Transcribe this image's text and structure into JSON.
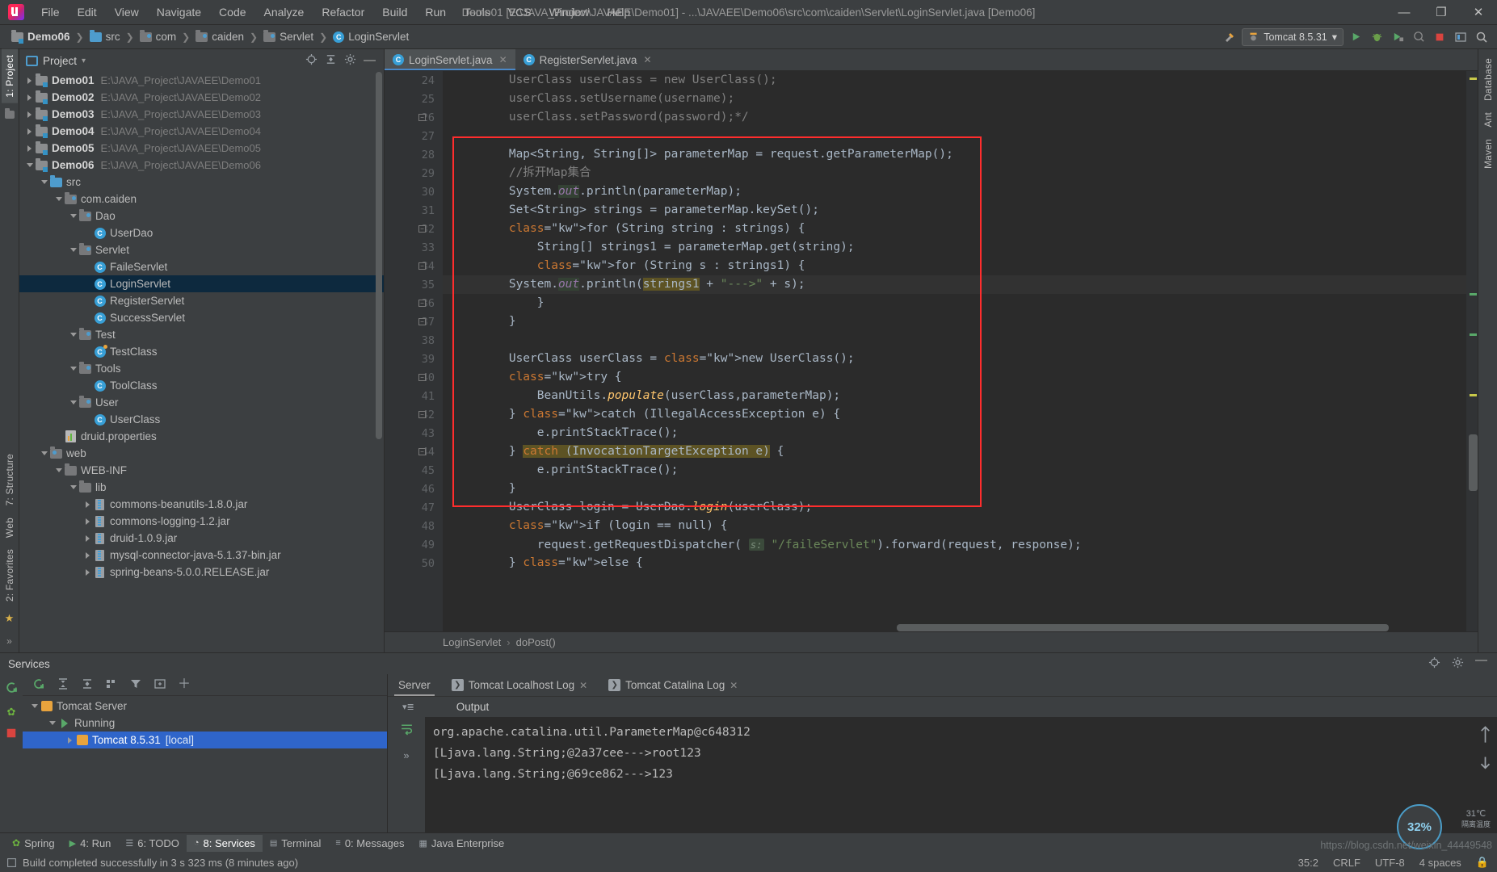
{
  "window": {
    "title": "Demo01 [E:\\JAVA_Project\\JAVAEE\\Demo01] - ...\\JAVAEE\\Demo06\\src\\com\\caiden\\Servlet\\LoginServlet.java [Demo06]",
    "minimize": "—",
    "maximize": "❐",
    "close": "✕"
  },
  "menu": [
    {
      "label": "File"
    },
    {
      "label": "Edit"
    },
    {
      "label": "View"
    },
    {
      "label": "Navigate"
    },
    {
      "label": "Code"
    },
    {
      "label": "Analyze"
    },
    {
      "label": "Refactor"
    },
    {
      "label": "Build"
    },
    {
      "label": "Run"
    },
    {
      "label": "Tools"
    },
    {
      "label": "VCS"
    },
    {
      "label": "Window"
    },
    {
      "label": "Help"
    }
  ],
  "breadcrumb": [
    {
      "label": "Demo06",
      "icon": "module-folder-icon",
      "bold": true
    },
    {
      "label": "src",
      "icon": "source-folder-icon",
      "bold": false
    },
    {
      "label": "com",
      "icon": "package-folder-icon",
      "bold": false
    },
    {
      "label": "caiden",
      "icon": "package-folder-icon",
      "bold": false
    },
    {
      "label": "Servlet",
      "icon": "package-folder-icon",
      "bold": false
    },
    {
      "label": "LoginServlet",
      "icon": "java-class-icon",
      "bold": false
    }
  ],
  "toolbar": {
    "run_config": "Tomcat 8.5.31",
    "dropdown_caret": "▾",
    "hammer_icon": "build-hammer-icon",
    "run_icon": "run-icon",
    "debug_icon": "debug-icon",
    "run_coverage_icon": "run-with-coverage-icon",
    "profile_icon": "profiler-icon",
    "stop_icon": "stop-icon",
    "layout_icon": "update-running-application-icon",
    "search_icon": "search-everywhere-icon"
  },
  "left_strip": {
    "tabs": [
      {
        "label": "1: Project",
        "active": true
      },
      {
        "label": "7: Structure",
        "active": false
      },
      {
        "label": "Web",
        "active": false
      },
      {
        "label": "2: Favorites",
        "active": false
      }
    ]
  },
  "right_strip": {
    "tabs": [
      {
        "label": "Database"
      },
      {
        "label": "Ant"
      },
      {
        "label": "Maven"
      }
    ]
  },
  "project_panel": {
    "title": "Project",
    "title_caret": "▾",
    "locate_icon": "scroll-from-source-icon",
    "collapse_icon": "collapse-all-icon",
    "settings_icon": "gear-icon",
    "hide_icon": "hide-icon",
    "tree": [
      {
        "indent": 0,
        "twist": "right",
        "icon": "module-icon",
        "label": "Demo01",
        "bold": true,
        "path": "E:\\JAVA_Project\\JAVAEE\\Demo01",
        "selected": false
      },
      {
        "indent": 0,
        "twist": "right",
        "icon": "module-icon",
        "label": "Demo02",
        "bold": true,
        "path": "E:\\JAVA_Project\\JAVAEE\\Demo02",
        "selected": false
      },
      {
        "indent": 0,
        "twist": "right",
        "icon": "module-icon",
        "label": "Demo03",
        "bold": true,
        "path": "E:\\JAVA_Project\\JAVAEE\\Demo03",
        "selected": false
      },
      {
        "indent": 0,
        "twist": "right",
        "icon": "module-icon",
        "label": "Demo04",
        "bold": true,
        "path": "E:\\JAVA_Project\\JAVAEE\\Demo04",
        "selected": false
      },
      {
        "indent": 0,
        "twist": "right",
        "icon": "module-icon",
        "label": "Demo05",
        "bold": true,
        "path": "E:\\JAVA_Project\\JAVAEE\\Demo05",
        "selected": false
      },
      {
        "indent": 0,
        "twist": "down",
        "icon": "module-icon",
        "label": "Demo06",
        "bold": true,
        "path": "E:\\JAVA_Project\\JAVAEE\\Demo06",
        "selected": false
      },
      {
        "indent": 1,
        "twist": "down",
        "icon": "source-folder-icon",
        "label": "src",
        "bold": false,
        "path": "",
        "selected": false
      },
      {
        "indent": 2,
        "twist": "down",
        "icon": "package-icon",
        "label": "com.caiden",
        "bold": false,
        "path": "",
        "selected": false
      },
      {
        "indent": 3,
        "twist": "down",
        "icon": "package-icon",
        "label": "Dao",
        "bold": false,
        "path": "",
        "selected": false
      },
      {
        "indent": 4,
        "twist": "none",
        "icon": "java-class-icon",
        "label": "UserDao",
        "bold": false,
        "path": "",
        "selected": false
      },
      {
        "indent": 3,
        "twist": "down",
        "icon": "package-icon",
        "label": "Servlet",
        "bold": false,
        "path": "",
        "selected": false
      },
      {
        "indent": 4,
        "twist": "none",
        "icon": "java-class-icon",
        "label": "FaileServlet",
        "bold": false,
        "path": "",
        "selected": false
      },
      {
        "indent": 4,
        "twist": "none",
        "icon": "java-class-icon",
        "label": "LoginServlet",
        "bold": false,
        "path": "",
        "selected": true
      },
      {
        "indent": 4,
        "twist": "none",
        "icon": "java-class-icon",
        "label": "RegisterServlet",
        "bold": false,
        "path": "",
        "selected": false
      },
      {
        "indent": 4,
        "twist": "none",
        "icon": "java-class-icon",
        "label": "SuccessServlet",
        "bold": false,
        "path": "",
        "selected": false
      },
      {
        "indent": 3,
        "twist": "down",
        "icon": "package-icon",
        "label": "Test",
        "bold": false,
        "path": "",
        "selected": false
      },
      {
        "indent": 4,
        "twist": "none",
        "icon": "java-test-class-icon",
        "label": "TestClass",
        "bold": false,
        "path": "",
        "selected": false
      },
      {
        "indent": 3,
        "twist": "down",
        "icon": "package-icon",
        "label": "Tools",
        "bold": false,
        "path": "",
        "selected": false
      },
      {
        "indent": 4,
        "twist": "none",
        "icon": "java-class-icon",
        "label": "ToolClass",
        "bold": false,
        "path": "",
        "selected": false
      },
      {
        "indent": 3,
        "twist": "down",
        "icon": "package-icon",
        "label": "User",
        "bold": false,
        "path": "",
        "selected": false
      },
      {
        "indent": 4,
        "twist": "none",
        "icon": "java-class-icon",
        "label": "UserClass",
        "bold": false,
        "path": "",
        "selected": false
      },
      {
        "indent": 2,
        "twist": "none",
        "icon": "properties-file-icon",
        "label": "druid.properties",
        "bold": false,
        "path": "",
        "selected": false
      },
      {
        "indent": 1,
        "twist": "down",
        "icon": "web-folder-icon",
        "label": "web",
        "bold": false,
        "path": "",
        "selected": false
      },
      {
        "indent": 2,
        "twist": "down",
        "icon": "folder-icon",
        "label": "WEB-INF",
        "bold": false,
        "path": "",
        "selected": false
      },
      {
        "indent": 3,
        "twist": "down",
        "icon": "folder-icon",
        "label": "lib",
        "bold": false,
        "path": "",
        "selected": false
      },
      {
        "indent": 4,
        "twist": "right",
        "icon": "jar-icon",
        "label": "commons-beanutils-1.8.0.jar",
        "bold": false,
        "path": "",
        "selected": false
      },
      {
        "indent": 4,
        "twist": "right",
        "icon": "jar-icon",
        "label": "commons-logging-1.2.jar",
        "bold": false,
        "path": "",
        "selected": false
      },
      {
        "indent": 4,
        "twist": "right",
        "icon": "jar-icon",
        "label": "druid-1.0.9.jar",
        "bold": false,
        "path": "",
        "selected": false
      },
      {
        "indent": 4,
        "twist": "right",
        "icon": "jar-icon",
        "label": "mysql-connector-java-5.1.37-bin.jar",
        "bold": false,
        "path": "",
        "selected": false
      },
      {
        "indent": 4,
        "twist": "right",
        "icon": "jar-icon",
        "label": "spring-beans-5.0.0.RELEASE.jar",
        "bold": false,
        "path": "",
        "selected": false
      }
    ]
  },
  "editor": {
    "tabs": [
      {
        "label": "LoginServlet.java",
        "active": true,
        "close": "✕"
      },
      {
        "label": "RegisterServlet.java",
        "active": false,
        "close": "✕"
      }
    ],
    "first_line_number": 24,
    "lines": [
      {
        "n": 24,
        "text": "        UserClass userClass = new UserClass();",
        "fold": false,
        "hl": false
      },
      {
        "n": 25,
        "text": "        userClass.setUsername(username);",
        "fold": false,
        "hl": false
      },
      {
        "n": 26,
        "text": "        userClass.setPassword(password);*/",
        "fold": true,
        "hl": false
      },
      {
        "n": 27,
        "text": "",
        "fold": false,
        "hl": false
      },
      {
        "n": 28,
        "text": "        Map<String, String[]> parameterMap = request.getParameterMap();",
        "fold": false,
        "hl": false
      },
      {
        "n": 29,
        "text": "        //拆开Map集合",
        "fold": false,
        "hl": false
      },
      {
        "n": 30,
        "text": "        System.out.println(parameterMap);",
        "fold": false,
        "hl": false
      },
      {
        "n": 31,
        "text": "        Set<String> strings = parameterMap.keySet();",
        "fold": false,
        "hl": false
      },
      {
        "n": 32,
        "text": "        for (String string : strings) {",
        "fold": true,
        "hl": false
      },
      {
        "n": 33,
        "text": "            String[] strings1 = parameterMap.get(string);",
        "fold": false,
        "hl": false
      },
      {
        "n": 34,
        "text": "            for (String s : strings1) {",
        "fold": true,
        "hl": false
      },
      {
        "n": 35,
        "text": "                System.out.println(strings1 + \"--->\" + s);",
        "fold": false,
        "hl": true
      },
      {
        "n": 36,
        "text": "            }",
        "fold": true,
        "hl": false
      },
      {
        "n": 37,
        "text": "        }",
        "fold": true,
        "hl": false
      },
      {
        "n": 38,
        "text": "",
        "fold": false,
        "hl": false
      },
      {
        "n": 39,
        "text": "        UserClass userClass = new UserClass();",
        "fold": false,
        "hl": false
      },
      {
        "n": 40,
        "text": "        try {",
        "fold": true,
        "hl": false
      },
      {
        "n": 41,
        "text": "            BeanUtils.populate(userClass,parameterMap);",
        "fold": false,
        "hl": false
      },
      {
        "n": 42,
        "text": "        } catch (IllegalAccessException e) {",
        "fold": true,
        "hl": false
      },
      {
        "n": 43,
        "text": "            e.printStackTrace();",
        "fold": false,
        "hl": false
      },
      {
        "n": 44,
        "text": "        } catch (InvocationTargetException e) {",
        "fold": true,
        "hl": false
      },
      {
        "n": 45,
        "text": "            e.printStackTrace();",
        "fold": false,
        "hl": false
      },
      {
        "n": 46,
        "text": "        }",
        "fold": false,
        "hl": false
      },
      {
        "n": 47,
        "text": "        UserClass login = UserDao.login(userClass);",
        "fold": false,
        "hl": false
      },
      {
        "n": 48,
        "text": "        if (login == null) {",
        "fold": false,
        "hl": false
      },
      {
        "n": 49,
        "text": "            request.getRequestDispatcher( s: \"/faileServlet\").forward(request, response);",
        "fold": false,
        "hl": false
      },
      {
        "n": 50,
        "text": "        } else {",
        "fold": false,
        "hl": false
      }
    ],
    "param_hint_49": "s:",
    "bottom_breadcrumb": {
      "class": "LoginServlet",
      "separator": "›",
      "method": "doPost()"
    }
  },
  "services": {
    "title": "Services",
    "locate_icon": "locate-icon",
    "settings_icon": "gear-icon",
    "hide_icon": "hide-icon",
    "toolbar": {
      "rerun_icon": "rerun-icon",
      "expand_icon": "expand-all-icon",
      "collapse_icon": "collapse-all-icon",
      "group_icon": "group-by-icon",
      "filter_icon": "filter-icon",
      "add_tab_icon": "add-tab-icon",
      "add_icon": "add-icon"
    },
    "tree": [
      {
        "indent": 0,
        "twist": "down",
        "icon": "tomcat-icon",
        "label": "Tomcat Server",
        "selected": false
      },
      {
        "indent": 1,
        "twist": "down",
        "icon": "run-green-icon",
        "label": "Running",
        "selected": false
      },
      {
        "indent": 2,
        "twist": "right",
        "icon": "tomcat-instance-icon",
        "label": "Tomcat 8.5.31",
        "suffix": "[local]",
        "selected": true
      }
    ],
    "tabs": [
      {
        "label": "Server",
        "active": true,
        "closable": false,
        "icon": ""
      },
      {
        "label": "Tomcat Localhost Log",
        "active": false,
        "closable": true,
        "close": "✕",
        "icon": "log-icon"
      },
      {
        "label": "Tomcat Catalina Log",
        "active": false,
        "closable": true,
        "close": "✕",
        "icon": "log-icon"
      }
    ],
    "output_label": "Output",
    "console_lines": [
      "org.apache.catalina.util.ParameterMap@c648312",
      "[Ljava.lang.String;@2a37cee--->root123",
      "[Ljava.lang.String;@69ce862--->123"
    ],
    "scroll_up_icon": "scroll-up-icon",
    "more_icon": "»"
  },
  "bottom_tabs": [
    {
      "label": "Spring",
      "icon": "spring-icon",
      "active": false
    },
    {
      "label": "4: Run",
      "icon": "run-icon",
      "active": false
    },
    {
      "label": "6: TODO",
      "icon": "todo-icon",
      "active": false
    },
    {
      "label": "8: Services",
      "icon": "services-icon",
      "active": true
    },
    {
      "label": "Terminal",
      "icon": "terminal-icon",
      "active": false
    },
    {
      "label": "0: Messages",
      "icon": "messages-icon",
      "active": false
    },
    {
      "label": "Java Enterprise",
      "icon": "java-enterprise-icon",
      "active": false
    }
  ],
  "statusbar": {
    "message": "Build completed successfully in 3 s 323 ms (8 minutes ago)",
    "event_icon": "event-log-icon",
    "caret_position": "35:2",
    "line_separator": "CRLF",
    "encoding": "UTF-8",
    "indent": "4 spaces",
    "lock_icon": "lock-icon"
  },
  "overlay": {
    "cpu_percent": "32%",
    "temp": "31℃",
    "temp_label": "隔离温度",
    "watermark": "https://blog.csdn.net/weixin_44449548"
  },
  "colors": {
    "accent": "#4a88c7",
    "selection": "#0d293e",
    "redbox": "#ff2d2d",
    "editor_bg": "#2b2b2b",
    "panel_bg": "#3c3f41",
    "tomcat_sel": "#2f65ca"
  }
}
